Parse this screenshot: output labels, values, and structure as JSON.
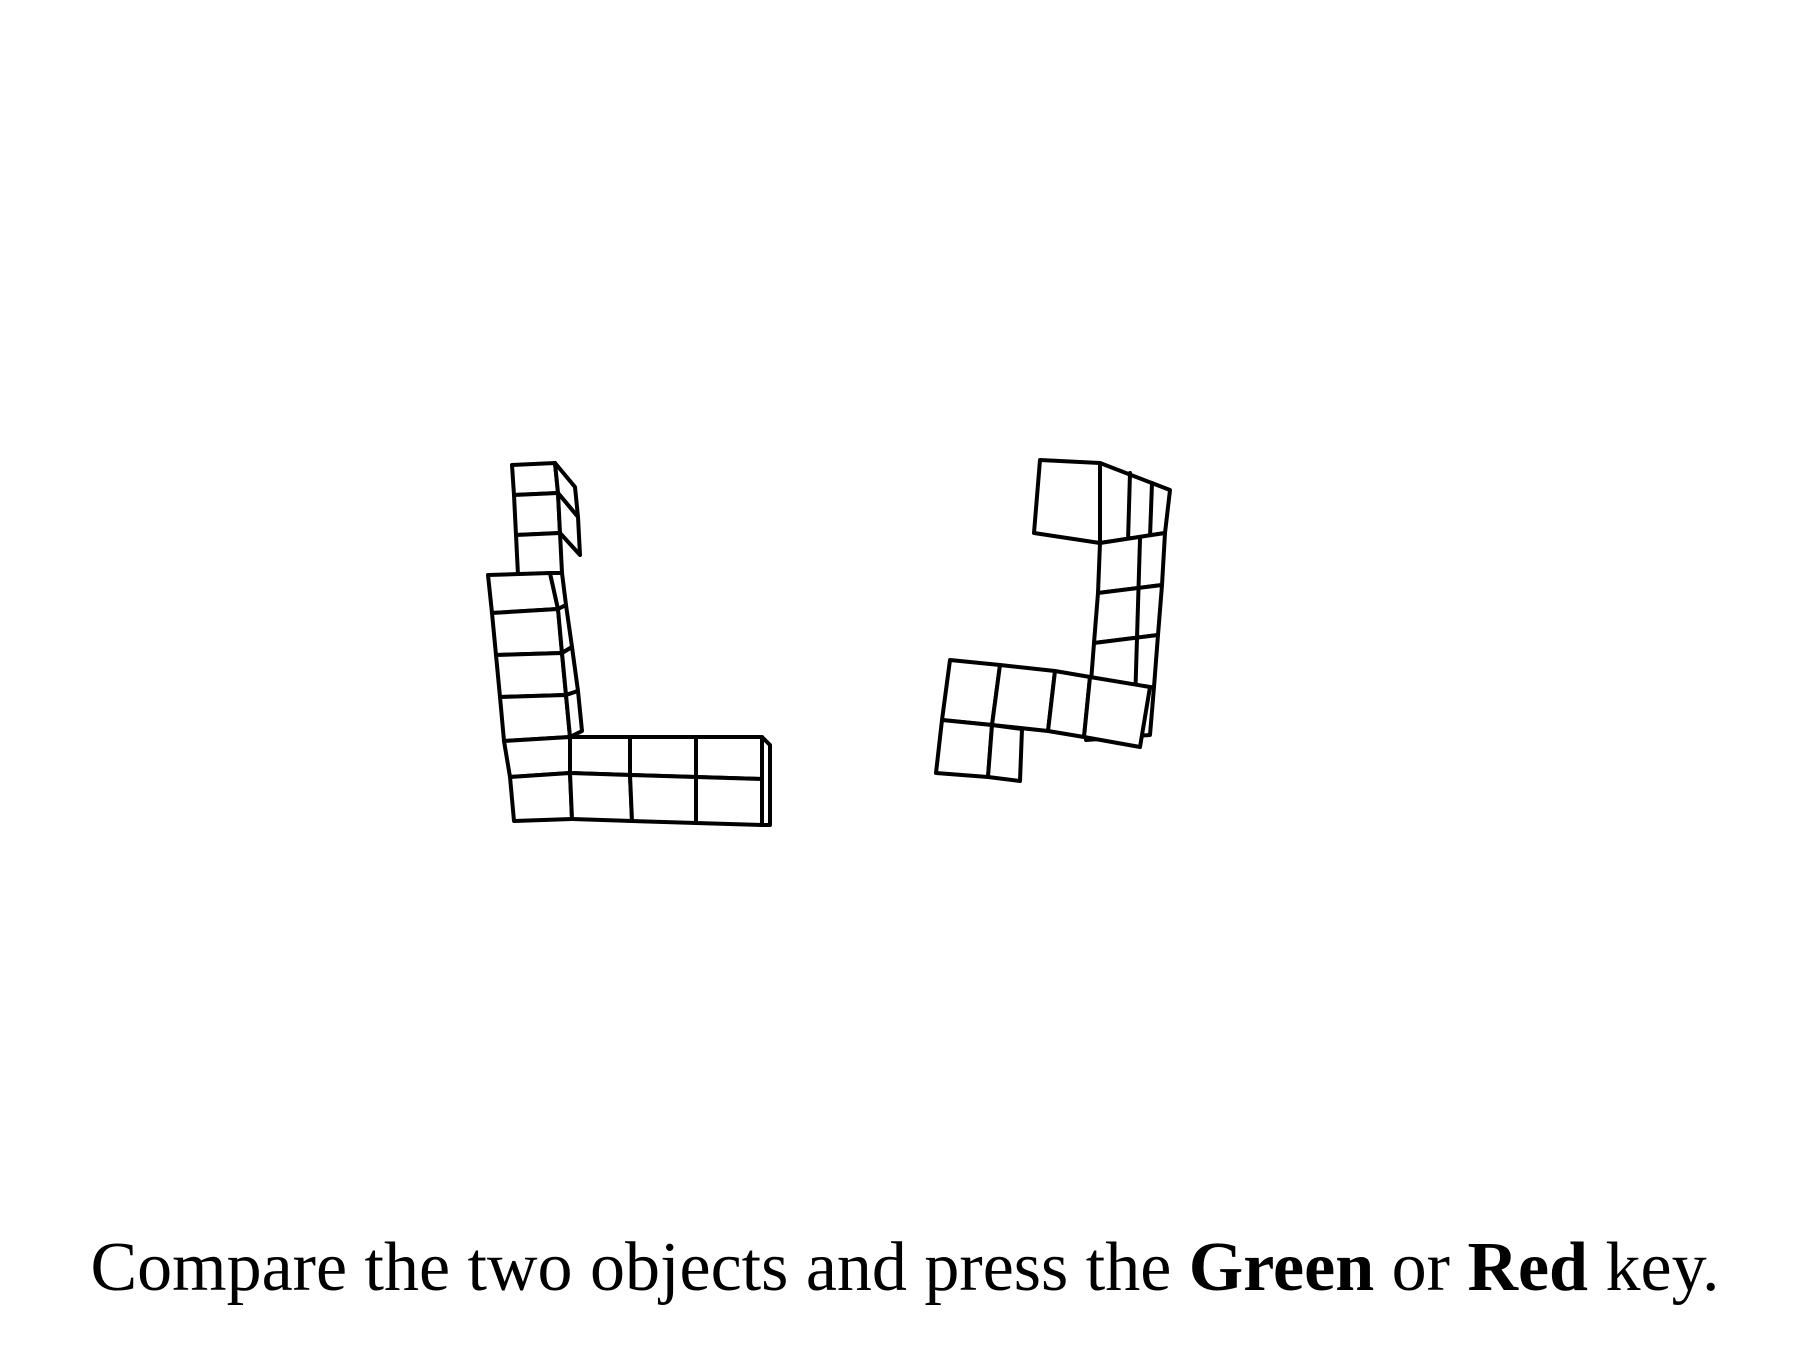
{
  "instruction": {
    "prefix": "Compare the two objects and press the ",
    "green_key": "Green",
    "middle": " or ",
    "red_key": "Red",
    "suffix": " key."
  },
  "objects": [
    {
      "id": "left",
      "icon": "cube-assembly-icon"
    },
    {
      "id": "right",
      "icon": "cube-assembly-icon"
    }
  ]
}
